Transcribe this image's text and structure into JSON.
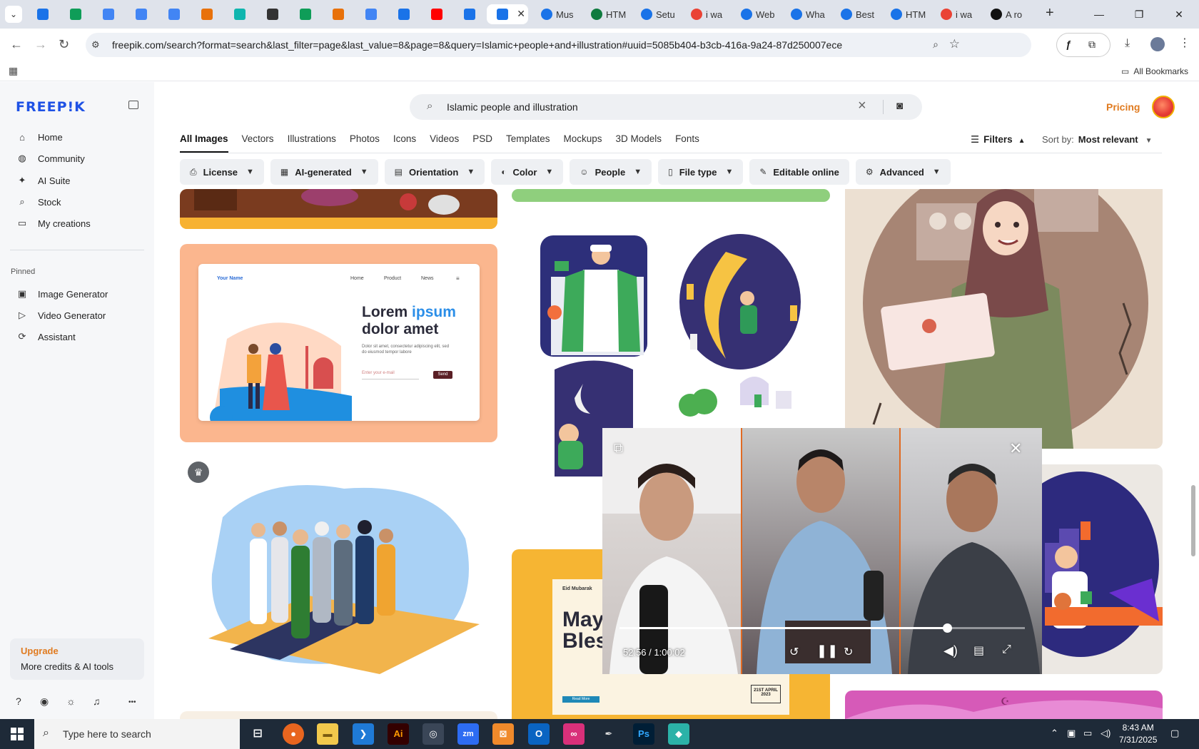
{
  "browser": {
    "tabs": [
      {
        "title": "",
        "color": "#1a73e8"
      },
      {
        "title": "",
        "color": "#0f9d58"
      },
      {
        "title": "",
        "color": "#4285f4"
      },
      {
        "title": "",
        "color": "#4285f4"
      },
      {
        "title": "",
        "color": "#4285f4"
      },
      {
        "title": "",
        "color": "#e8710a"
      },
      {
        "title": "",
        "color": "#0fb5ae"
      },
      {
        "title": "",
        "color": "#333333"
      },
      {
        "title": "",
        "color": "#0f9d58"
      },
      {
        "title": "",
        "color": "#e8710a"
      },
      {
        "title": "",
        "color": "#4285f4"
      },
      {
        "title": "",
        "color": "#1a73e8"
      },
      {
        "title": "",
        "color": "#ff0000"
      },
      {
        "title": "",
        "color": "#1a73e8"
      }
    ],
    "active_tab_close": "✕",
    "named_tabs": [
      {
        "title": "Mus",
        "color": "#1a73e8"
      },
      {
        "title": "HTM",
        "color": "#0f7b3f"
      },
      {
        "title": "Setu",
        "color": "#1a73e8"
      },
      {
        "title": "i wa",
        "color": "#ea4335"
      },
      {
        "title": "Web",
        "color": "#1a73e8"
      },
      {
        "title": "Wha",
        "color": "#1a73e8"
      },
      {
        "title": "Best",
        "color": "#1a73e8"
      },
      {
        "title": "HTM",
        "color": "#1a73e8"
      },
      {
        "title": "i wa",
        "color": "#ea4335"
      },
      {
        "title": "A ro",
        "color": "#111111"
      }
    ],
    "url": "freepik.com/search?format=search&last_filter=page&last_value=8&page=8&query=Islamic+people+and+illustration#uuid=5085b404-b3cb-416a-9a24-87d250007ece",
    "bookmarks_label": "All Bookmarks"
  },
  "sidebar": {
    "logo": "FREEP!K",
    "items": [
      {
        "label": "Home",
        "icon": "⌂"
      },
      {
        "label": "Community",
        "icon": "◍"
      },
      {
        "label": "AI Suite",
        "icon": "✦"
      },
      {
        "label": "Stock",
        "icon": "⌕"
      },
      {
        "label": "My creations",
        "icon": "▭"
      }
    ],
    "pinned_label": "Pinned",
    "pinned": [
      {
        "label": "Image Generator",
        "icon": "▣"
      },
      {
        "label": "Video Generator",
        "icon": "▷"
      },
      {
        "label": "Assistant",
        "icon": "⟳"
      }
    ],
    "upgrade_title": "Upgrade",
    "upgrade_sub": "More credits & AI tools",
    "more": "•••"
  },
  "header": {
    "search_query": "Islamic people and illustration",
    "pricing": "Pricing"
  },
  "category_tabs": [
    "All Images",
    "Vectors",
    "Illustrations",
    "Photos",
    "Icons",
    "Videos",
    "PSD",
    "Templates",
    "Mockups",
    "3D Models",
    "Fonts"
  ],
  "filters_label": "Filters",
  "sort": {
    "label": "Sort by:",
    "value": "Most relevant"
  },
  "filter_chips": [
    {
      "label": "License",
      "icon": "⎙"
    },
    {
      "label": "AI-generated",
      "icon": "▦"
    },
    {
      "label": "Orientation",
      "icon": "▤"
    },
    {
      "label": "Color",
      "icon": "◐"
    },
    {
      "label": "People",
      "icon": "☺"
    },
    {
      "label": "File type",
      "icon": "▯"
    },
    {
      "label": "Editable online",
      "icon": "✎"
    },
    {
      "label": "Advanced",
      "icon": "⚙"
    }
  ],
  "landing_card": {
    "brand": "Your Name",
    "nav": [
      "Home",
      "Product",
      "News"
    ],
    "headline1": "Lorem",
    "headline_accent": "ipsum",
    "headline2": "dolor amet",
    "body": "Dolor sit amet, consectetur adipiscing elit, sed do eiusmod tempor labore",
    "email_placeholder": "Enter your e-mail",
    "send": "Send"
  },
  "poster_card": {
    "tag": "Eid Mubarak",
    "title1": "May",
    "title2": "Bles",
    "date": "21ST APRIL 2023",
    "cta": "Read More"
  },
  "video": {
    "time": "52:56 / 1:00:02",
    "progress": 0.808
  },
  "taskbar": {
    "search_placeholder": "Type here to search",
    "time": "8:43 AM",
    "date": "7/31/2025"
  }
}
